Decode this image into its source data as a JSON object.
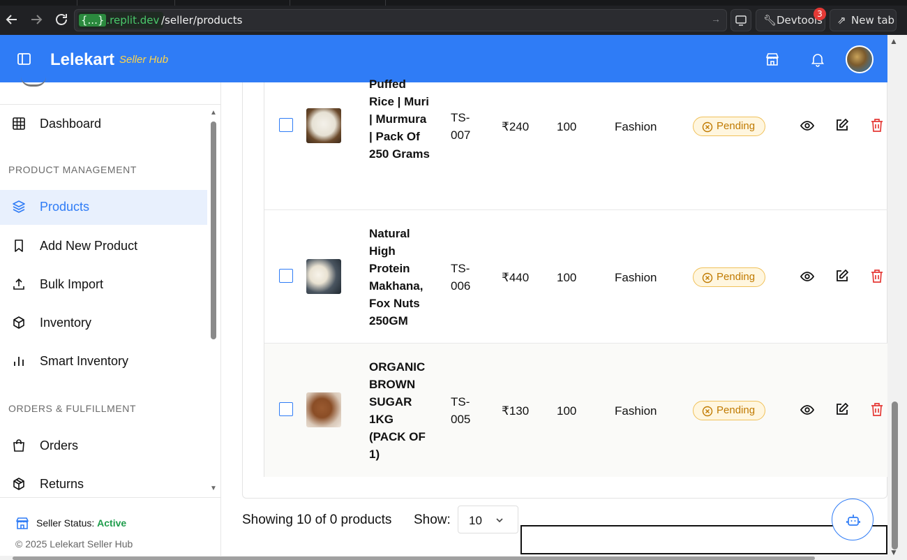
{
  "browser": {
    "url_host_braces": "{...}",
    "url_host": ".replit.dev",
    "url_path": "/seller/products",
    "devtools_label": "Devtools",
    "devtools_badge": "3",
    "newtab_label": "New tab"
  },
  "header": {
    "brand": "Lelekart",
    "brand_sub": "Seller Hub",
    "brand_color": "#2f7cf6",
    "sub_color": "#ffd54a"
  },
  "sidebar": {
    "dashboard": "Dashboard",
    "section_product": "PRODUCT MANAGEMENT",
    "products": "Products",
    "add_new": "Add New Product",
    "bulk_import": "Bulk Import",
    "inventory": "Inventory",
    "smart_inventory": "Smart Inventory",
    "section_orders": "ORDERS & FULFILLMENT",
    "orders": "Orders",
    "returns": "Returns",
    "status_label": "Seller Status:",
    "status_value": "Active",
    "copyright": "© 2025 Lelekart Seller Hub"
  },
  "products": [
    {
      "name": "Puffed Rice | Muri | Murmura | Pack Of 250 Grams",
      "sku": "TS-007",
      "price": "₹240",
      "stock": "100",
      "category": "Fashion",
      "status": "Pending"
    },
    {
      "name": "Natural High Protein Makhana, Fox Nuts 250GM",
      "sku": "TS-006",
      "price": "₹440",
      "stock": "100",
      "category": "Fashion",
      "status": "Pending"
    },
    {
      "name": "ORGANIC BROWN SUGAR 1KG (PACK OF 1)",
      "sku": "TS-005",
      "price": "₹130",
      "stock": "100",
      "category": "Fashion",
      "status": "Pending"
    }
  ],
  "footer": {
    "showing": "Showing 10 of 0 products",
    "show_label": "Show:",
    "page_size": "10"
  }
}
